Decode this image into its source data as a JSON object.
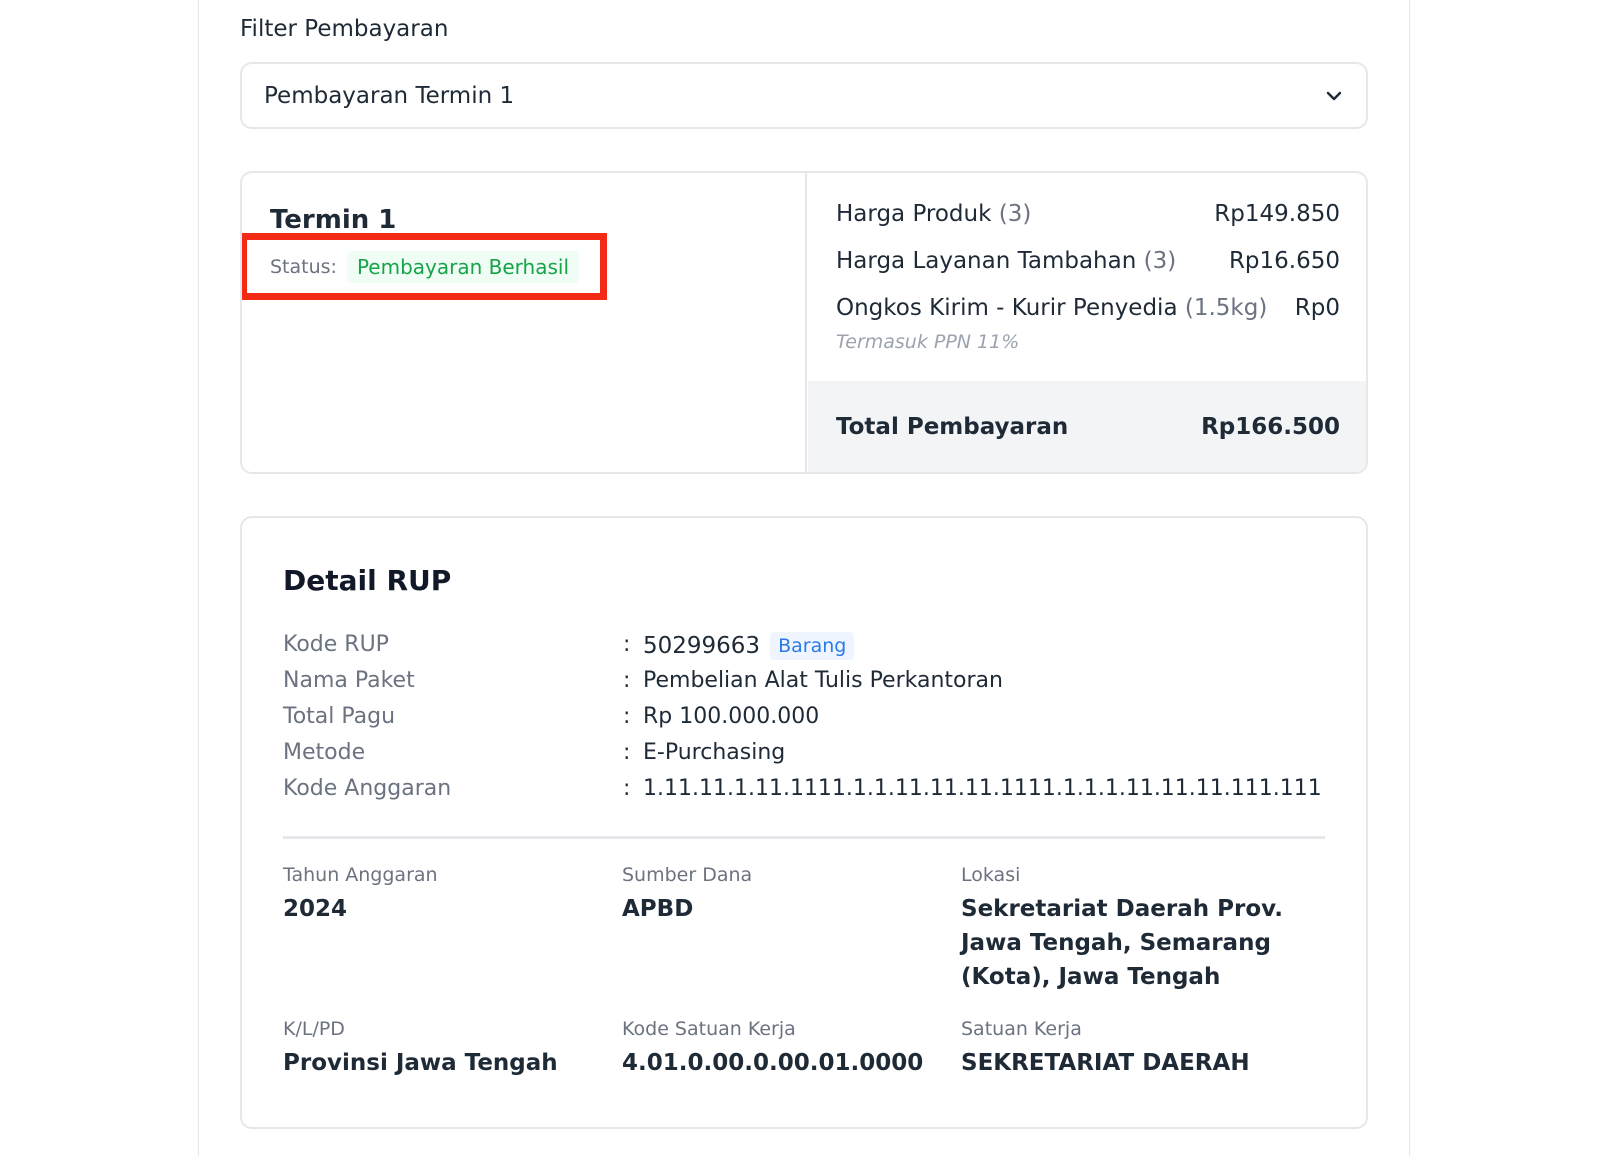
{
  "filter": {
    "label": "Filter Pembayaran",
    "selected": "Pembayaran Termin 1"
  },
  "termin": {
    "title": "Termin 1",
    "status_label": "Status:",
    "status_value": "Pembayaran Berhasil",
    "status_color": "#16a34a",
    "highlight_color": "#f22a16",
    "prices": [
      {
        "label": "Harga Produk",
        "qty": "(3)",
        "value": "Rp149.850"
      },
      {
        "label": "Harga Layanan Tambahan",
        "qty": "(3)",
        "value": "Rp16.650"
      },
      {
        "label": "Ongkos Kirim - Kurir Penyedia",
        "qty": "(1.5kg)",
        "value": "Rp0"
      }
    ],
    "ppn_note": "Termasuk PPN 11%",
    "total_label": "Total Pembayaran",
    "total_value": "Rp166.500"
  },
  "rup": {
    "title": "Detail RUP",
    "rows": [
      {
        "key": "Kode RUP",
        "value": "50299663",
        "badge": "Barang"
      },
      {
        "key": "Nama Paket",
        "value": "Pembelian Alat Tulis Perkantoran"
      },
      {
        "key": "Total Pagu",
        "value": "Rp 100.000.000"
      },
      {
        "key": "Metode",
        "value": "E-Purchasing"
      },
      {
        "key": "Kode Anggaran",
        "value": "1.11.11.1.11.1111.1.1.11.11.11.1111.1.1.1.11.11.11.111.111"
      }
    ],
    "colon": ":",
    "info": [
      {
        "label": "Tahun Anggaran",
        "value": "2024"
      },
      {
        "label": "Sumber Dana",
        "value": "APBD"
      },
      {
        "label": "Lokasi",
        "value": "Sekretariat Daerah Prov. Jawa Tengah, Semarang (Kota), Jawa Tengah"
      },
      {
        "label": "K/L/PD",
        "value": "Provinsi Jawa Tengah"
      },
      {
        "label": "Kode Satuan Kerja",
        "value": "4.01.0.00.0.00.01.0000"
      },
      {
        "label": "Satuan Kerja",
        "value": "SEKRETARIAT DAERAH"
      }
    ],
    "badge_color": "#2b7be5"
  }
}
